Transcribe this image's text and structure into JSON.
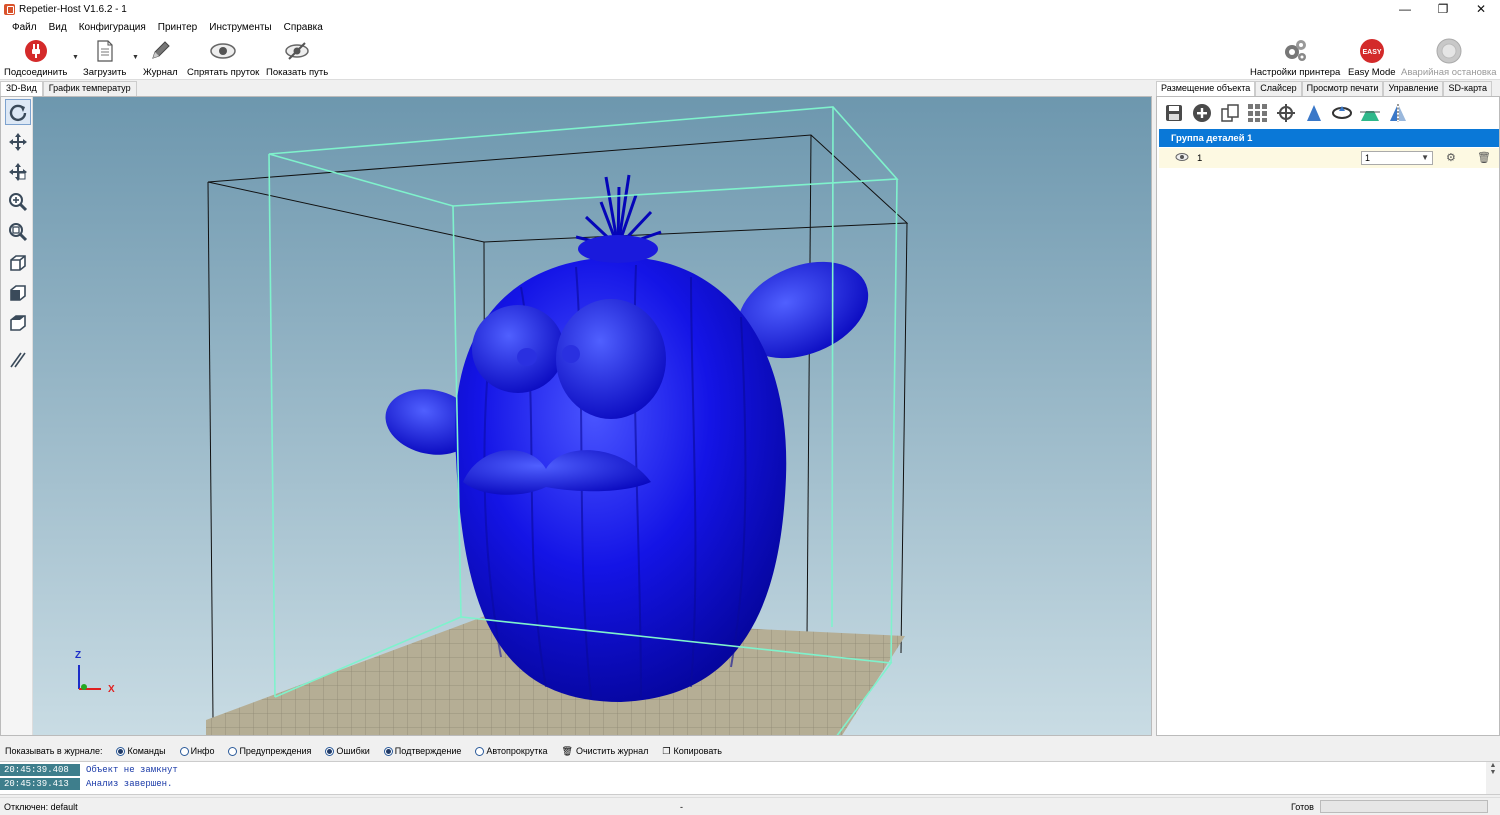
{
  "window": {
    "title": "Repetier-Host V1.6.2 - 1",
    "min": "—",
    "max": "❐",
    "close": "✕"
  },
  "menu": [
    "Файл",
    "Вид",
    "Конфигурация",
    "Принтер",
    "Инструменты",
    "Справка"
  ],
  "toolbar": {
    "connect": "Подсоединить",
    "load": "Загрузить",
    "log": "Журнал",
    "hide_filament": "Спрятать пруток",
    "show_path": "Показать путь",
    "printer_settings": "Настройки принтера",
    "easy_mode": "Easy Mode",
    "easy_badge": "EASY",
    "emergency_stop": "Аварийная остановка"
  },
  "view_tabs": [
    "3D-Вид",
    "График температур"
  ],
  "axes": {
    "z": "Z",
    "x": "X"
  },
  "right_tabs": [
    "Размещение объекта",
    "Слайсер",
    "Просмотр печати",
    "Управление",
    "SD-карта"
  ],
  "object_panel": {
    "group_title": "Группа деталей 1",
    "object_name": "1",
    "object_copies": "1"
  },
  "log": {
    "show_label": "Показывать в журнале:",
    "options": [
      {
        "label": "Команды",
        "on": true
      },
      {
        "label": "Инфо",
        "on": false
      },
      {
        "label": "Предупреждения",
        "on": false
      },
      {
        "label": "Ошибки",
        "on": true
      },
      {
        "label": "Подтверждение",
        "on": true
      },
      {
        "label": "Автопрокрутка",
        "on": false
      }
    ],
    "clear": "Очистить журнал",
    "copy": "Копировать",
    "entries": [
      {
        "time": "20:45:39.408",
        "text": "Объект не замкнут"
      },
      {
        "time": "20:45:39.413",
        "text": "Анализ завершен."
      }
    ]
  },
  "status": {
    "connection": "Отключен: default",
    "middle": "-",
    "state": "Готов"
  },
  "colors": {
    "model": "#1010e0",
    "bed": "#b5ae95",
    "frame": "#7ff2cc",
    "bg_top": "#6d97ae",
    "bg_bottom": "#c9dce4",
    "selection": "#0a78d7"
  }
}
